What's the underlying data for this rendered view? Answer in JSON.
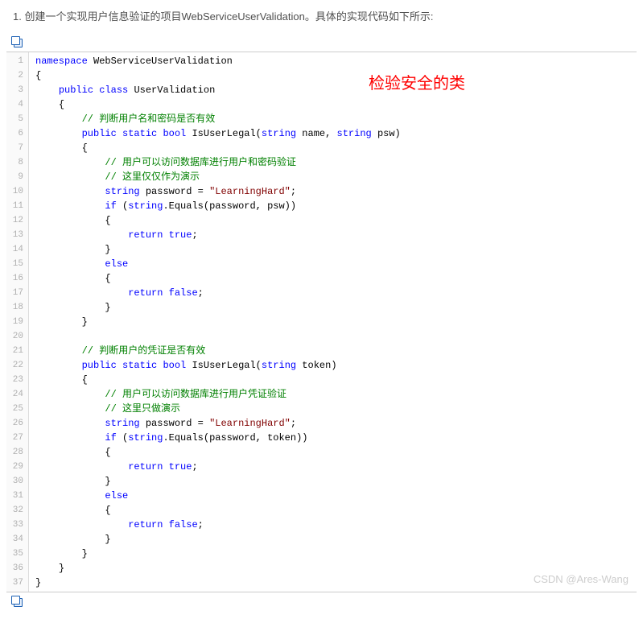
{
  "heading": "1. 创建一个实现用户信息验证的项目WebServiceUserValidation。具体的实现代码如下所示:",
  "annotation": "检验安全的类",
  "watermark": "CSDN @Ares-Wang",
  "copy_icon_name": "copy-icon",
  "code": {
    "line_count": 37,
    "lines": [
      {
        "indent": 0,
        "tokens": [
          {
            "t": "kw",
            "v": "namespace"
          },
          {
            "t": "pl",
            "v": " WebServiceUserValidation"
          }
        ]
      },
      {
        "indent": 0,
        "tokens": [
          {
            "t": "pl",
            "v": "{"
          }
        ]
      },
      {
        "indent": 1,
        "tokens": [
          {
            "t": "kw",
            "v": "public"
          },
          {
            "t": "pl",
            "v": " "
          },
          {
            "t": "kw",
            "v": "class"
          },
          {
            "t": "pl",
            "v": " UserValidation"
          }
        ]
      },
      {
        "indent": 1,
        "tokens": [
          {
            "t": "pl",
            "v": "{"
          }
        ]
      },
      {
        "indent": 2,
        "tokens": [
          {
            "t": "cm",
            "v": "// 判断用户名和密码是否有效"
          }
        ]
      },
      {
        "indent": 2,
        "tokens": [
          {
            "t": "kw",
            "v": "public"
          },
          {
            "t": "pl",
            "v": " "
          },
          {
            "t": "kw",
            "v": "static"
          },
          {
            "t": "pl",
            "v": " "
          },
          {
            "t": "kw",
            "v": "bool"
          },
          {
            "t": "pl",
            "v": " IsUserLegal("
          },
          {
            "t": "kw",
            "v": "string"
          },
          {
            "t": "pl",
            "v": " name, "
          },
          {
            "t": "kw",
            "v": "string"
          },
          {
            "t": "pl",
            "v": " psw)"
          }
        ]
      },
      {
        "indent": 2,
        "tokens": [
          {
            "t": "pl",
            "v": "{"
          }
        ]
      },
      {
        "indent": 3,
        "tokens": [
          {
            "t": "cm",
            "v": "// 用户可以访问数据库进行用户和密码验证"
          }
        ]
      },
      {
        "indent": 3,
        "tokens": [
          {
            "t": "cm",
            "v": "// 这里仅仅作为演示"
          }
        ]
      },
      {
        "indent": 3,
        "tokens": [
          {
            "t": "kw",
            "v": "string"
          },
          {
            "t": "pl",
            "v": " password = "
          },
          {
            "t": "str",
            "v": "\"LearningHard\""
          },
          {
            "t": "pl",
            "v": ";"
          }
        ]
      },
      {
        "indent": 3,
        "tokens": [
          {
            "t": "kw",
            "v": "if"
          },
          {
            "t": "pl",
            "v": " ("
          },
          {
            "t": "kw",
            "v": "string"
          },
          {
            "t": "pl",
            "v": ".Equals(password, psw))"
          }
        ]
      },
      {
        "indent": 3,
        "tokens": [
          {
            "t": "pl",
            "v": "{"
          }
        ]
      },
      {
        "indent": 4,
        "tokens": [
          {
            "t": "kw",
            "v": "return"
          },
          {
            "t": "pl",
            "v": " "
          },
          {
            "t": "kw",
            "v": "true"
          },
          {
            "t": "pl",
            "v": ";"
          }
        ]
      },
      {
        "indent": 3,
        "tokens": [
          {
            "t": "pl",
            "v": "}"
          }
        ]
      },
      {
        "indent": 3,
        "tokens": [
          {
            "t": "kw",
            "v": "else"
          }
        ]
      },
      {
        "indent": 3,
        "tokens": [
          {
            "t": "pl",
            "v": "{"
          }
        ]
      },
      {
        "indent": 4,
        "tokens": [
          {
            "t": "kw",
            "v": "return"
          },
          {
            "t": "pl",
            "v": " "
          },
          {
            "t": "kw",
            "v": "false"
          },
          {
            "t": "pl",
            "v": ";"
          }
        ]
      },
      {
        "indent": 3,
        "tokens": [
          {
            "t": "pl",
            "v": "}"
          }
        ]
      },
      {
        "indent": 2,
        "tokens": [
          {
            "t": "pl",
            "v": "}"
          }
        ]
      },
      {
        "indent": 0,
        "tokens": []
      },
      {
        "indent": 2,
        "tokens": [
          {
            "t": "cm",
            "v": "// 判断用户的凭证是否有效"
          }
        ]
      },
      {
        "indent": 2,
        "tokens": [
          {
            "t": "kw",
            "v": "public"
          },
          {
            "t": "pl",
            "v": " "
          },
          {
            "t": "kw",
            "v": "static"
          },
          {
            "t": "pl",
            "v": " "
          },
          {
            "t": "kw",
            "v": "bool"
          },
          {
            "t": "pl",
            "v": " IsUserLegal("
          },
          {
            "t": "kw",
            "v": "string"
          },
          {
            "t": "pl",
            "v": " token)"
          }
        ]
      },
      {
        "indent": 2,
        "tokens": [
          {
            "t": "pl",
            "v": "{"
          }
        ]
      },
      {
        "indent": 3,
        "tokens": [
          {
            "t": "cm",
            "v": "// 用户可以访问数据库进行用户凭证验证"
          }
        ]
      },
      {
        "indent": 3,
        "tokens": [
          {
            "t": "cm",
            "v": "// 这里只做演示"
          }
        ]
      },
      {
        "indent": 3,
        "tokens": [
          {
            "t": "kw",
            "v": "string"
          },
          {
            "t": "pl",
            "v": " password = "
          },
          {
            "t": "str",
            "v": "\"LearningHard\""
          },
          {
            "t": "pl",
            "v": ";"
          }
        ]
      },
      {
        "indent": 3,
        "tokens": [
          {
            "t": "kw",
            "v": "if"
          },
          {
            "t": "pl",
            "v": " ("
          },
          {
            "t": "kw",
            "v": "string"
          },
          {
            "t": "pl",
            "v": ".Equals(password, token))"
          }
        ]
      },
      {
        "indent": 3,
        "tokens": [
          {
            "t": "pl",
            "v": "{"
          }
        ]
      },
      {
        "indent": 4,
        "tokens": [
          {
            "t": "kw",
            "v": "return"
          },
          {
            "t": "pl",
            "v": " "
          },
          {
            "t": "kw",
            "v": "true"
          },
          {
            "t": "pl",
            "v": ";"
          }
        ]
      },
      {
        "indent": 3,
        "tokens": [
          {
            "t": "pl",
            "v": "}"
          }
        ]
      },
      {
        "indent": 3,
        "tokens": [
          {
            "t": "kw",
            "v": "else"
          }
        ]
      },
      {
        "indent": 3,
        "tokens": [
          {
            "t": "pl",
            "v": "{"
          }
        ]
      },
      {
        "indent": 4,
        "tokens": [
          {
            "t": "kw",
            "v": "return"
          },
          {
            "t": "pl",
            "v": " "
          },
          {
            "t": "kw",
            "v": "false"
          },
          {
            "t": "pl",
            "v": ";"
          }
        ]
      },
      {
        "indent": 3,
        "tokens": [
          {
            "t": "pl",
            "v": "}"
          }
        ]
      },
      {
        "indent": 2,
        "tokens": [
          {
            "t": "pl",
            "v": "}"
          }
        ]
      },
      {
        "indent": 1,
        "tokens": [
          {
            "t": "pl",
            "v": "}"
          }
        ]
      },
      {
        "indent": 0,
        "tokens": [
          {
            "t": "pl",
            "v": "}"
          }
        ]
      }
    ]
  }
}
